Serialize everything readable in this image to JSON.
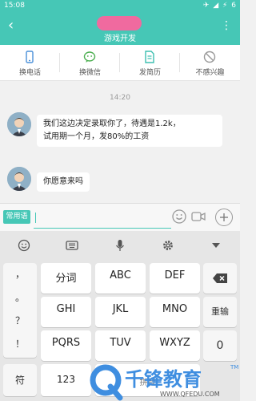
{
  "status": {
    "time": "15:08",
    "battery": "6"
  },
  "header": {
    "title": "游戏开发"
  },
  "actions": [
    {
      "label": "换电话",
      "icon": "phone-icon"
    },
    {
      "label": "换微信",
      "icon": "wechat-icon"
    },
    {
      "label": "发简历",
      "icon": "resume-icon"
    },
    {
      "label": "不感兴趣",
      "icon": "not-interested-icon"
    }
  ],
  "chat": {
    "timestamp": "14:20",
    "messages": [
      {
        "line1": "我们这边决定录取你了，待遇是1.2k，",
        "line2": "试用期一个月，发80%的工资"
      },
      {
        "line1": "你愿意来吗"
      }
    ]
  },
  "input": {
    "quick_label": "常用语",
    "value": ""
  },
  "keyboard": {
    "left_keys": [
      "，",
      "。",
      "？",
      "！"
    ],
    "keys": [
      {
        "main": "分词",
        "sub": ""
      },
      {
        "main": "ABC",
        "sub": ""
      },
      {
        "main": "DEF",
        "sub": ""
      },
      {
        "main": "GHI",
        "sub": ""
      },
      {
        "main": "JKL",
        "sub": ""
      },
      {
        "main": "MNO",
        "sub": ""
      },
      {
        "main": "PQRS",
        "sub": ""
      },
      {
        "main": "TUV",
        "sub": ""
      },
      {
        "main": "WXYZ",
        "sub": ""
      }
    ],
    "reenter": "重输",
    "symbol": "符",
    "num": "123",
    "pinyin": "拼音"
  },
  "watermark": {
    "text": "千锋教育",
    "url": "WWW.QFEDU.COM",
    "tm": "TM"
  },
  "colors": {
    "accent": "#46c7b6",
    "avatar_bg": "#8fb0c6"
  }
}
